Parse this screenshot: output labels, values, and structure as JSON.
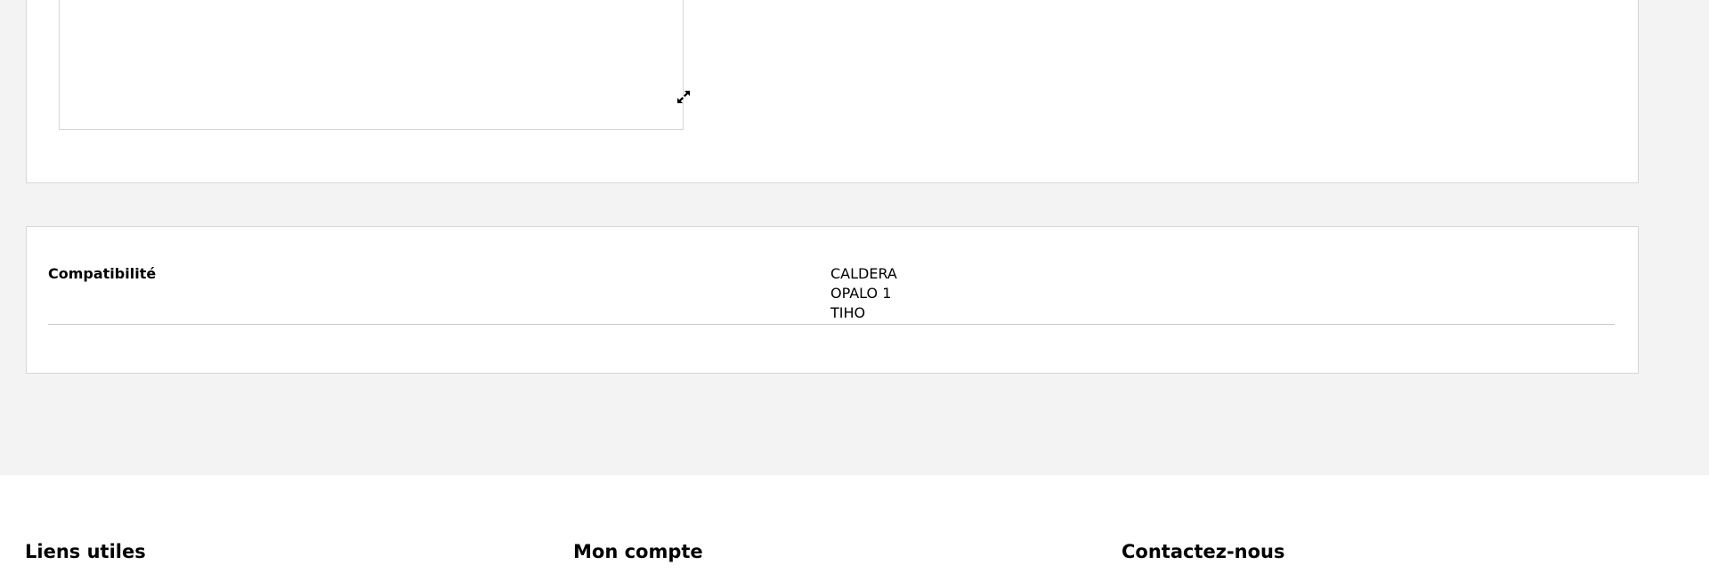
{
  "product_media": {
    "expand_icon": "expand-arrows-icon"
  },
  "specifications": {
    "rows": [
      {
        "label": "Compatibilité",
        "values": [
          "CALDERA",
          "OPALO 1",
          "TIHO"
        ]
      }
    ]
  },
  "footer": {
    "columns": [
      {
        "heading": "Liens utiles"
      },
      {
        "heading": "Mon compte"
      },
      {
        "heading": "Contactez-nous"
      }
    ]
  }
}
